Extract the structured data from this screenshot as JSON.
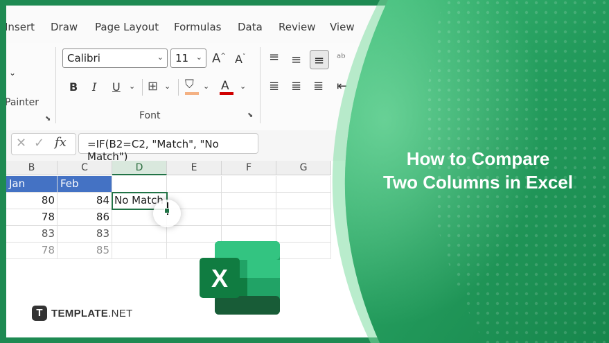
{
  "ribbon": {
    "tabs": [
      "Insert",
      "Draw",
      "Page Layout",
      "Formulas",
      "Data",
      "Review",
      "View"
    ],
    "clipboard": {
      "painter_label": "Painter"
    },
    "font": {
      "name": "Calibri",
      "size": "11",
      "group_label": "Font",
      "grow_label": "A",
      "shrink_label": "A",
      "bold": "B",
      "italic": "I",
      "underline": "U"
    }
  },
  "formula_bar": {
    "cancel_glyph": "✕",
    "enter_glyph": "✓",
    "fx_label": "fx",
    "formula": "=IF(B2=C2, \"Match\", \"No Match\")"
  },
  "sheet": {
    "columns": [
      "B",
      "C",
      "D",
      "E",
      "F",
      "G"
    ],
    "selected_column": "D",
    "header_row": [
      "Jan",
      "Feb"
    ],
    "rows": [
      {
        "b": "80",
        "c": "84",
        "d": "No Match"
      },
      {
        "b": "78",
        "c": "86",
        "d": ""
      },
      {
        "b": "83",
        "c": "83",
        "d": ""
      },
      {
        "b": "78",
        "c": "85",
        "d": ""
      }
    ]
  },
  "title": "How to Compare Two Columns in Excel",
  "brand": {
    "badge": "T",
    "name_bold": "TEMPLATE",
    "name_rest": ".NET"
  },
  "excel_logo_letter": "X",
  "colors": {
    "excel_green": "#217346",
    "table_header_blue": "#4472c4",
    "brand_green": "#1e8a52"
  }
}
